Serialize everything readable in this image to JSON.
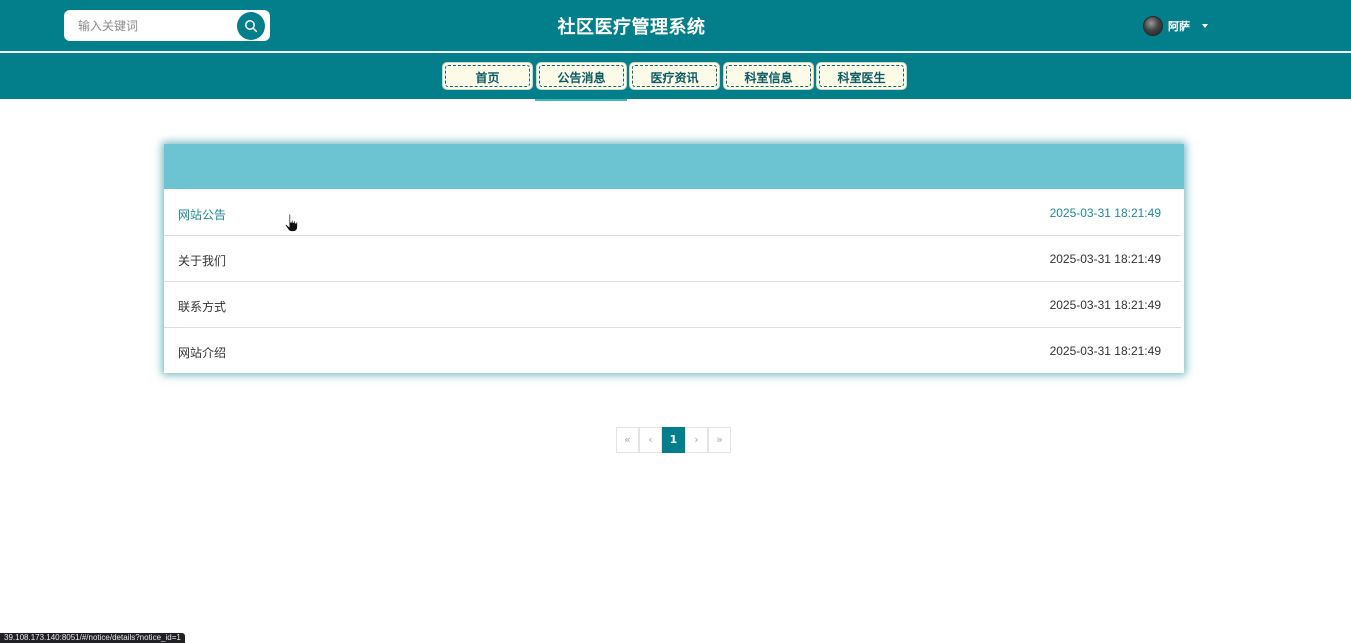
{
  "header": {
    "search_placeholder": "输入关键词",
    "site_title": "社区医疗管理系统",
    "username": "阿萨"
  },
  "nav": {
    "items": [
      {
        "label": "首页"
      },
      {
        "label": "公告消息",
        "active": true
      },
      {
        "label": "医疗资讯"
      },
      {
        "label": "科室信息"
      },
      {
        "label": "科室医生"
      }
    ]
  },
  "notices": [
    {
      "title": "网站公告",
      "time": "2025-03-31 18:21:49",
      "hovered": true
    },
    {
      "title": "关于我们",
      "time": "2025-03-31 18:21:49"
    },
    {
      "title": "联系方式",
      "time": "2025-03-31 18:21:49"
    },
    {
      "title": "网站介绍",
      "time": "2025-03-31 18:21:49"
    }
  ],
  "pagination": {
    "first": "«",
    "prev": "‹",
    "current": "1",
    "next": "›",
    "last": "»"
  },
  "status_bar": {
    "url": "39.108.173.140:8051/#/notice/details?notice_id=1"
  },
  "colors": {
    "primary": "#037f8c",
    "card_header": "#6cc3d1",
    "nav_button_bg": "#fbfbe8",
    "link_hover": "#1a8a96"
  },
  "icons": {
    "search": "search-icon",
    "user_caret": "caret-down-icon",
    "cursor": "hand-pointer-icon"
  }
}
